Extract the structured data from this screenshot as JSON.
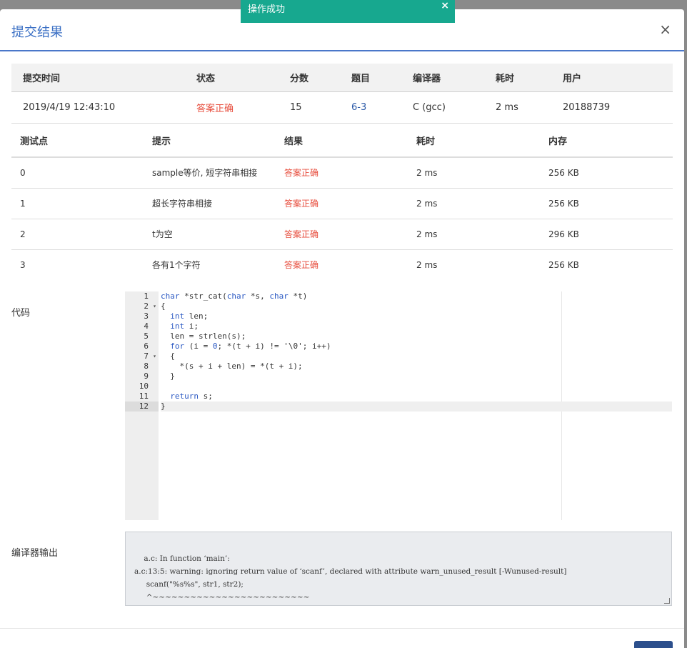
{
  "toast": {
    "message": "操作成功",
    "close": "×"
  },
  "modal": {
    "title": "提交结果",
    "close": "×"
  },
  "summary": {
    "headers": [
      "提交时间",
      "状态",
      "分数",
      "题目",
      "编译器",
      "耗时",
      "用户"
    ],
    "row": {
      "time": "2019/4/19 12:43:10",
      "status": "答案正确",
      "score": "15",
      "problem": "6-3",
      "compiler": "C (gcc)",
      "elapsed": "2 ms",
      "user": "20188739"
    }
  },
  "cases": {
    "headers": [
      "测试点",
      "提示",
      "结果",
      "耗时",
      "内存"
    ],
    "rows": [
      {
        "id": "0",
        "hint": "sample等价, 短字符串相接",
        "result": "答案正确",
        "time": "2 ms",
        "memory": "256 KB"
      },
      {
        "id": "1",
        "hint": "超长字符串相接",
        "result": "答案正确",
        "time": "2 ms",
        "memory": "256 KB"
      },
      {
        "id": "2",
        "hint": "t为空",
        "result": "答案正确",
        "time": "2 ms",
        "memory": "296 KB"
      },
      {
        "id": "3",
        "hint": "各有1个字符",
        "result": "答案正确",
        "time": "2 ms",
        "memory": "256 KB"
      }
    ]
  },
  "code_section": {
    "label": "代码",
    "line_numbers": [
      "1",
      "2",
      "3",
      "4",
      "5",
      "6",
      "7",
      "8",
      "9",
      "10",
      "11",
      "12"
    ],
    "fold_marker": "▾"
  },
  "compiler_section": {
    "label": "编译器输出",
    "output": "a.c: In function ‘main’:\na.c:13:5: warning: ignoring return value of ‘scanf’, declared with attribute warn_unused_result [-Wunused-result]\n     scanf(\"%s%s\", str1, str2);\n     ^~~~~~~~~~~~~~~~~~~~~~~~~~"
  },
  "colors": {
    "toast_bg": "#17a88f",
    "accent": "#3a6fc4",
    "status_correct": "#e74c3c",
    "link": "#2b59a7"
  }
}
